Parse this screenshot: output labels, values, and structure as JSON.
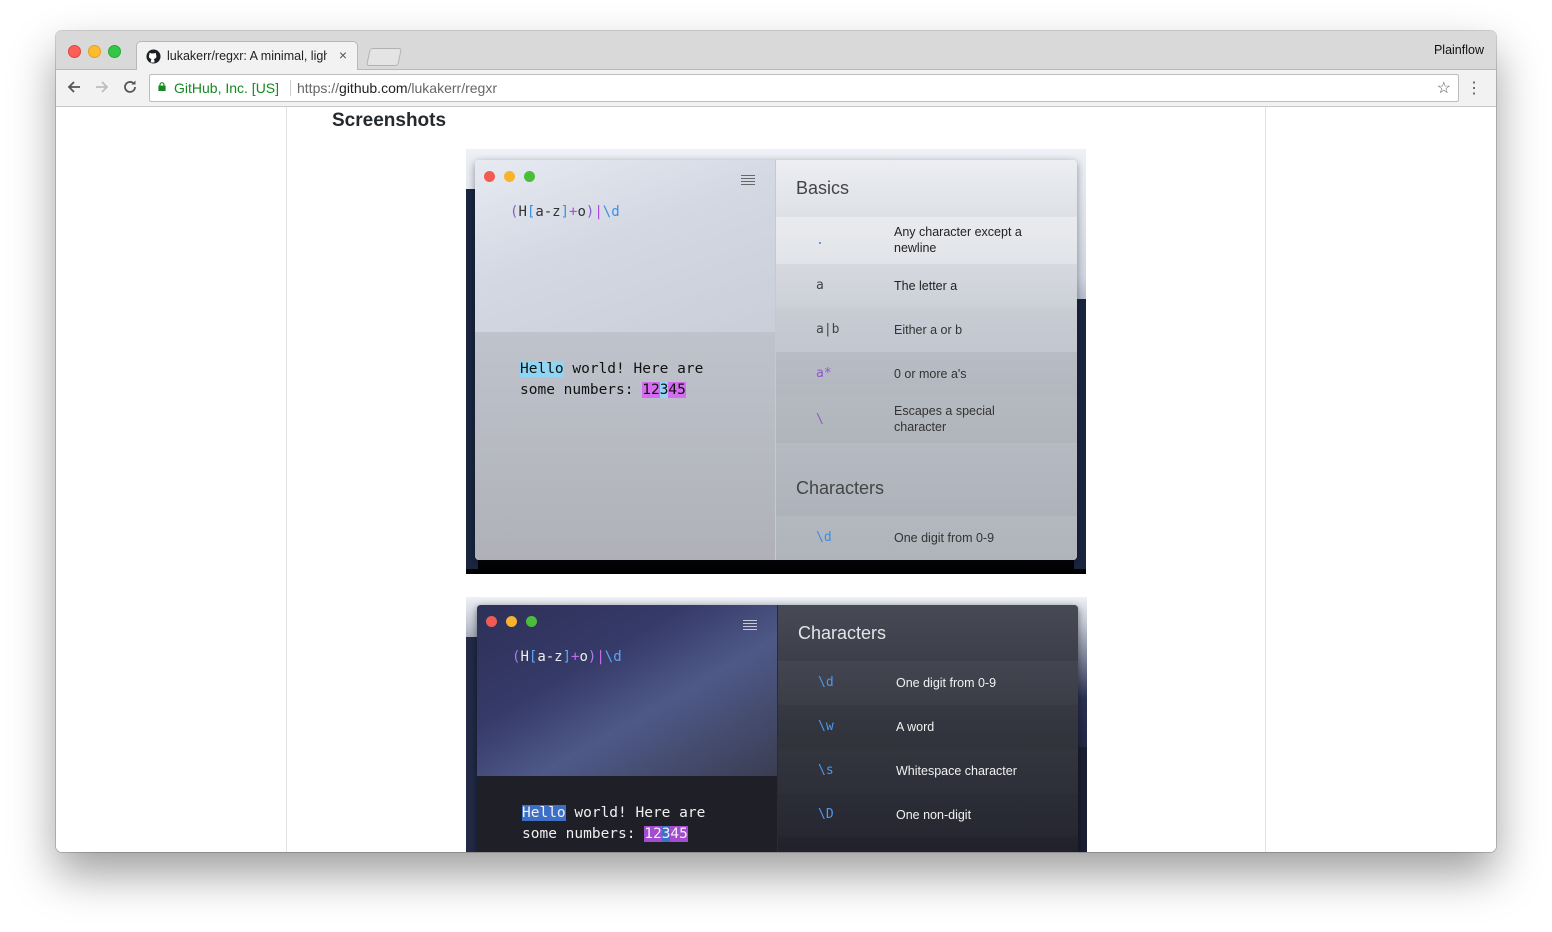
{
  "browser": {
    "tab_title": "lukakerr/regxr: A minimal, light",
    "tab_close": "×",
    "profile_name": "Plainflow",
    "ev_cert": "GitHub, Inc. [US]",
    "url_scheme": "https://",
    "url_host": "github.com",
    "url_path": "/lukakerr/regxr",
    "icons": {
      "back": "arrow-left",
      "forward": "arrow-right",
      "reload": "refresh",
      "bookmark": "star",
      "menu": "kebab",
      "favicon": "github"
    }
  },
  "page": {
    "heading": "Screenshots"
  },
  "shot_light": {
    "regex": {
      "open": "(",
      "h": "H",
      "br_open": "[",
      "range": "a-z",
      "br_close": "]",
      "plus": "+",
      "o": "o",
      "close": ")",
      "pipe": "|",
      "digit": "\\d"
    },
    "test_text": {
      "match1": "Hello",
      "line1_rest": " world! Here are",
      "line2_start": "some numbers: ",
      "n1": "12",
      "n2": "3",
      "n3": "45"
    },
    "sections": [
      {
        "title": "Basics"
      },
      {
        "title": "Characters"
      }
    ],
    "basics": [
      {
        "token": ".",
        "desc": "Any character except a newline"
      },
      {
        "token": "a",
        "desc": "The letter a"
      },
      {
        "token": "a|b",
        "desc": "Either a or b"
      },
      {
        "token": "a*",
        "desc": "0 or more a's"
      },
      {
        "token": "\\",
        "desc": "Escapes a special character"
      }
    ],
    "characters": [
      {
        "token": "\\d",
        "desc": "One digit from 0-9"
      }
    ]
  },
  "shot_dark": {
    "regex": {
      "open": "(",
      "h": "H",
      "br_open": "[",
      "range": "a-z",
      "br_close": "]",
      "plus": "+",
      "o": "o",
      "close": ")",
      "pipe": "|",
      "digit": "\\d"
    },
    "test_text": {
      "match1": "Hello",
      "line1_rest": " world! Here are",
      "line2_start": "some numbers: ",
      "n1": "12",
      "n2": "3",
      "n3": "45"
    },
    "section_title": "Characters",
    "characters": [
      {
        "token": "\\d",
        "desc": "One digit from 0-9"
      },
      {
        "token": "\\w",
        "desc": "A word"
      },
      {
        "token": "\\s",
        "desc": "Whitespace character"
      },
      {
        "token": "\\D",
        "desc": "One non-digit"
      }
    ]
  },
  "colors": {
    "regex_blue": "#3a8ee6",
    "regex_purple": "#b147e0",
    "match_cyan": "#8fd6f5",
    "match_magenta": "#d46bf0",
    "dark_match_blue": "#3d6fc7",
    "dark_match_magenta": "#a34bd1"
  }
}
